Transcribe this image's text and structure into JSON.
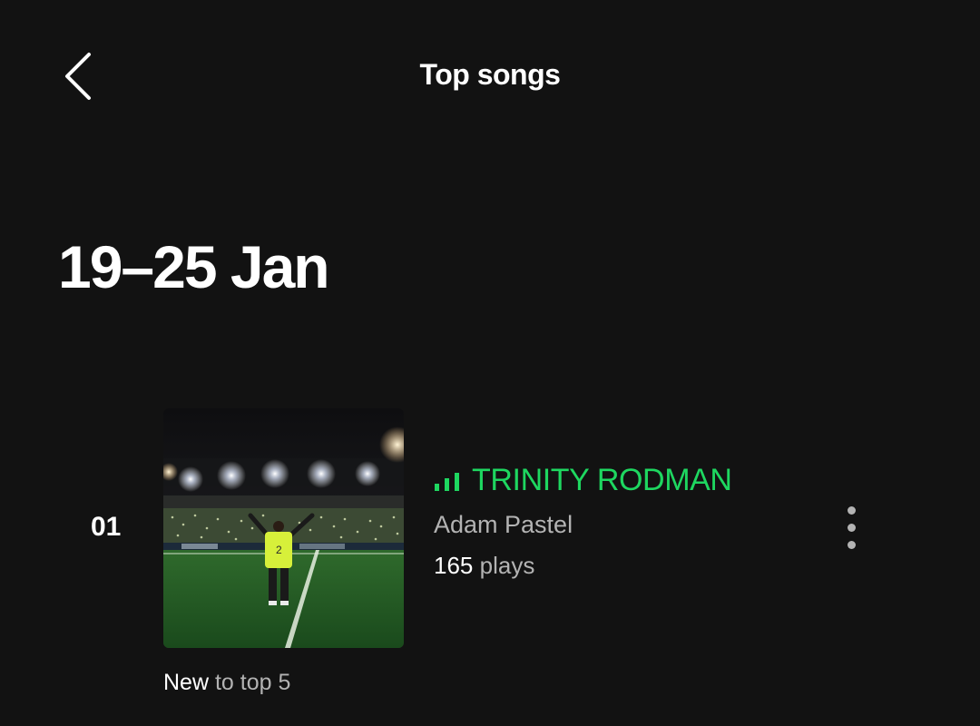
{
  "header": {
    "title": "Top songs",
    "back_icon": "chevron-left-icon"
  },
  "week": {
    "title": "19–25 Jan"
  },
  "songs": [
    {
      "rank": "01",
      "title": "TRINITY RODMAN",
      "artist": "Adam Pastel",
      "plays_count": "165",
      "plays_label": "plays",
      "badge_strong": "New",
      "badge_rest": "to top 5",
      "now_playing_icon": "equalizer-bars-icon",
      "more_icon": "more-vertical-icon"
    }
  ],
  "colors": {
    "background": "#121212",
    "accent": "#1ed760",
    "secondary_text": "#b3b3b3"
  }
}
